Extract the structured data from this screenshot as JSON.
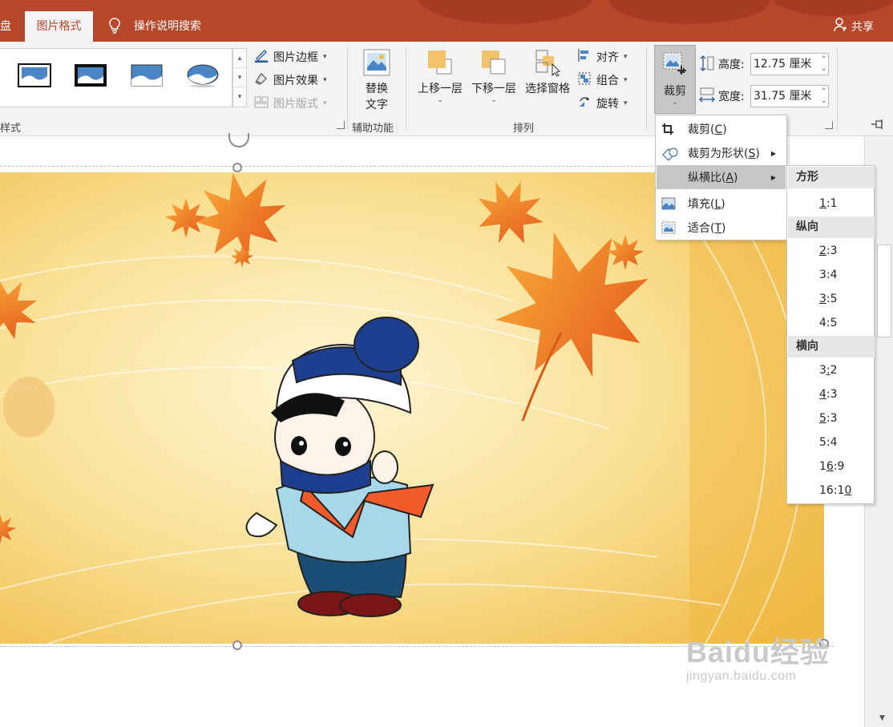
{
  "tabs": {
    "partial_left": "盘",
    "active": "图片格式",
    "search": "操作说明搜索",
    "share": "共享"
  },
  "ribbon": {
    "picture_styles_label_partial": "样式",
    "picture_border": "图片边框",
    "picture_effects": "图片效果",
    "picture_layout": "图片版式",
    "alt_text_line1": "替换",
    "alt_text_line2": "文字",
    "accessibility_label": "辅助功能",
    "bring_forward": "上移一层",
    "send_backward": "下移一层",
    "selection_pane": "选择窗格",
    "align": "对齐",
    "group": "组合",
    "rotate": "旋转",
    "arrange_label": "排列",
    "crop": "裁剪",
    "height_label": "高度:",
    "height_value": "12.75 厘米",
    "width_label": "宽度:",
    "width_value": "31.75 厘米"
  },
  "crop_menu": {
    "crop": {
      "text": "裁剪(",
      "key": "C",
      "end": ")"
    },
    "crop_to_shape": {
      "text": "裁剪为形状(",
      "key": "S",
      "end": ")"
    },
    "aspect_ratio": {
      "text": "纵横比(",
      "key": "A",
      "end": ")"
    },
    "fill": {
      "text": "填充(",
      "key": "L",
      "end": ")"
    },
    "fit": {
      "text": "适合(",
      "key": "T",
      "end": ")"
    }
  },
  "ratio_menu": {
    "square_header": "方形",
    "square": [
      {
        "pre": "",
        "key": "1",
        "post": ":1"
      }
    ],
    "portrait_header": "纵向",
    "portrait": [
      {
        "pre": "",
        "key": "2",
        "post": ":3"
      },
      {
        "pre": "3:4",
        "key": "",
        "post": ""
      },
      {
        "pre": "",
        "key": "3",
        "post": ":5"
      },
      {
        "pre": "4:5",
        "key": "",
        "post": ""
      }
    ],
    "landscape_header": "横向",
    "landscape": [
      {
        "pre": "3",
        "key": ":",
        "post": "2"
      },
      {
        "pre": "",
        "key": "4",
        "post": ":3"
      },
      {
        "pre": "",
        "key": "5",
        "post": ":3"
      },
      {
        "pre": "5:4",
        "key": "",
        "post": ""
      },
      {
        "pre": "1",
        "key": "6",
        "post": ":9"
      },
      {
        "pre": "16:1",
        "key": "0",
        "post": ""
      }
    ]
  },
  "watermark": {
    "main": "Baidu经验",
    "sub": "jingyan.baidu.com"
  },
  "colors": {
    "accent": "#b7472a",
    "ribbon_bg": "#f3f3f3",
    "menu_highlight": "#c6c6c6",
    "picture_bg": "#f7d57e"
  },
  "icons": [
    "lightbulb-icon",
    "person-icon",
    "crop-icon",
    "pin-icon"
  ]
}
